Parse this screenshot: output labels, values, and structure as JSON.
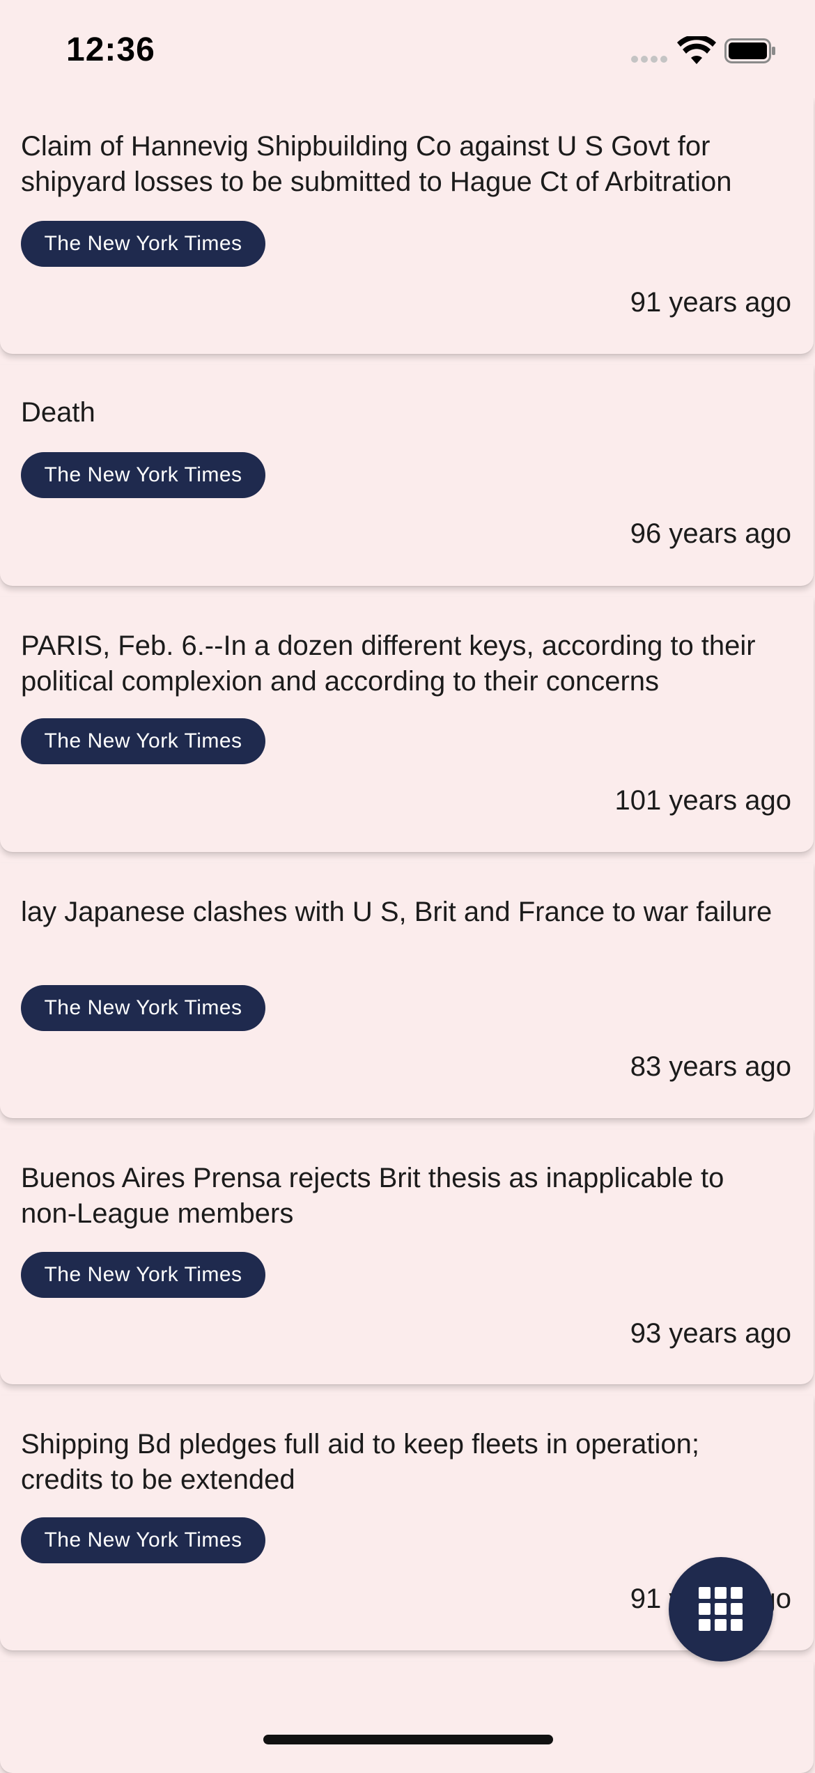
{
  "status_bar": {
    "time": "12:36"
  },
  "articles": [
    {
      "title": "Claim of Hannevig Shipbuilding Co against U S Govt for shipyard losses to be submitted to Hague Ct of Arbitration",
      "source": "The New York Times",
      "age": "91 years ago"
    },
    {
      "title": "Death",
      "source": "The New York Times",
      "age": "96 years ago"
    },
    {
      "title": "PARIS, Feb. 6.--In a dozen different keys, according to their political complexion and according to their concerns",
      "source": "The New York Times",
      "age": "101 years ago"
    },
    {
      "title": "lay Japanese clashes with U S, Brit and France to war failure",
      "source": "The New York Times",
      "age": "83 years ago"
    },
    {
      "title": "Buenos Aires Prensa rejects Brit thesis as inapplicable to non-League members",
      "source": "The New York Times",
      "age": "93 years ago"
    },
    {
      "title": "Shipping Bd pledges full aid to keep fleets in operation; credits to be extended",
      "source": "The New York Times",
      "age": "91 years ago"
    }
  ],
  "fab": {
    "icon": "grid-menu-icon"
  },
  "colors": {
    "background": "#fbecec",
    "chip": "#1f2a4e",
    "chip_text": "#ffffff"
  }
}
